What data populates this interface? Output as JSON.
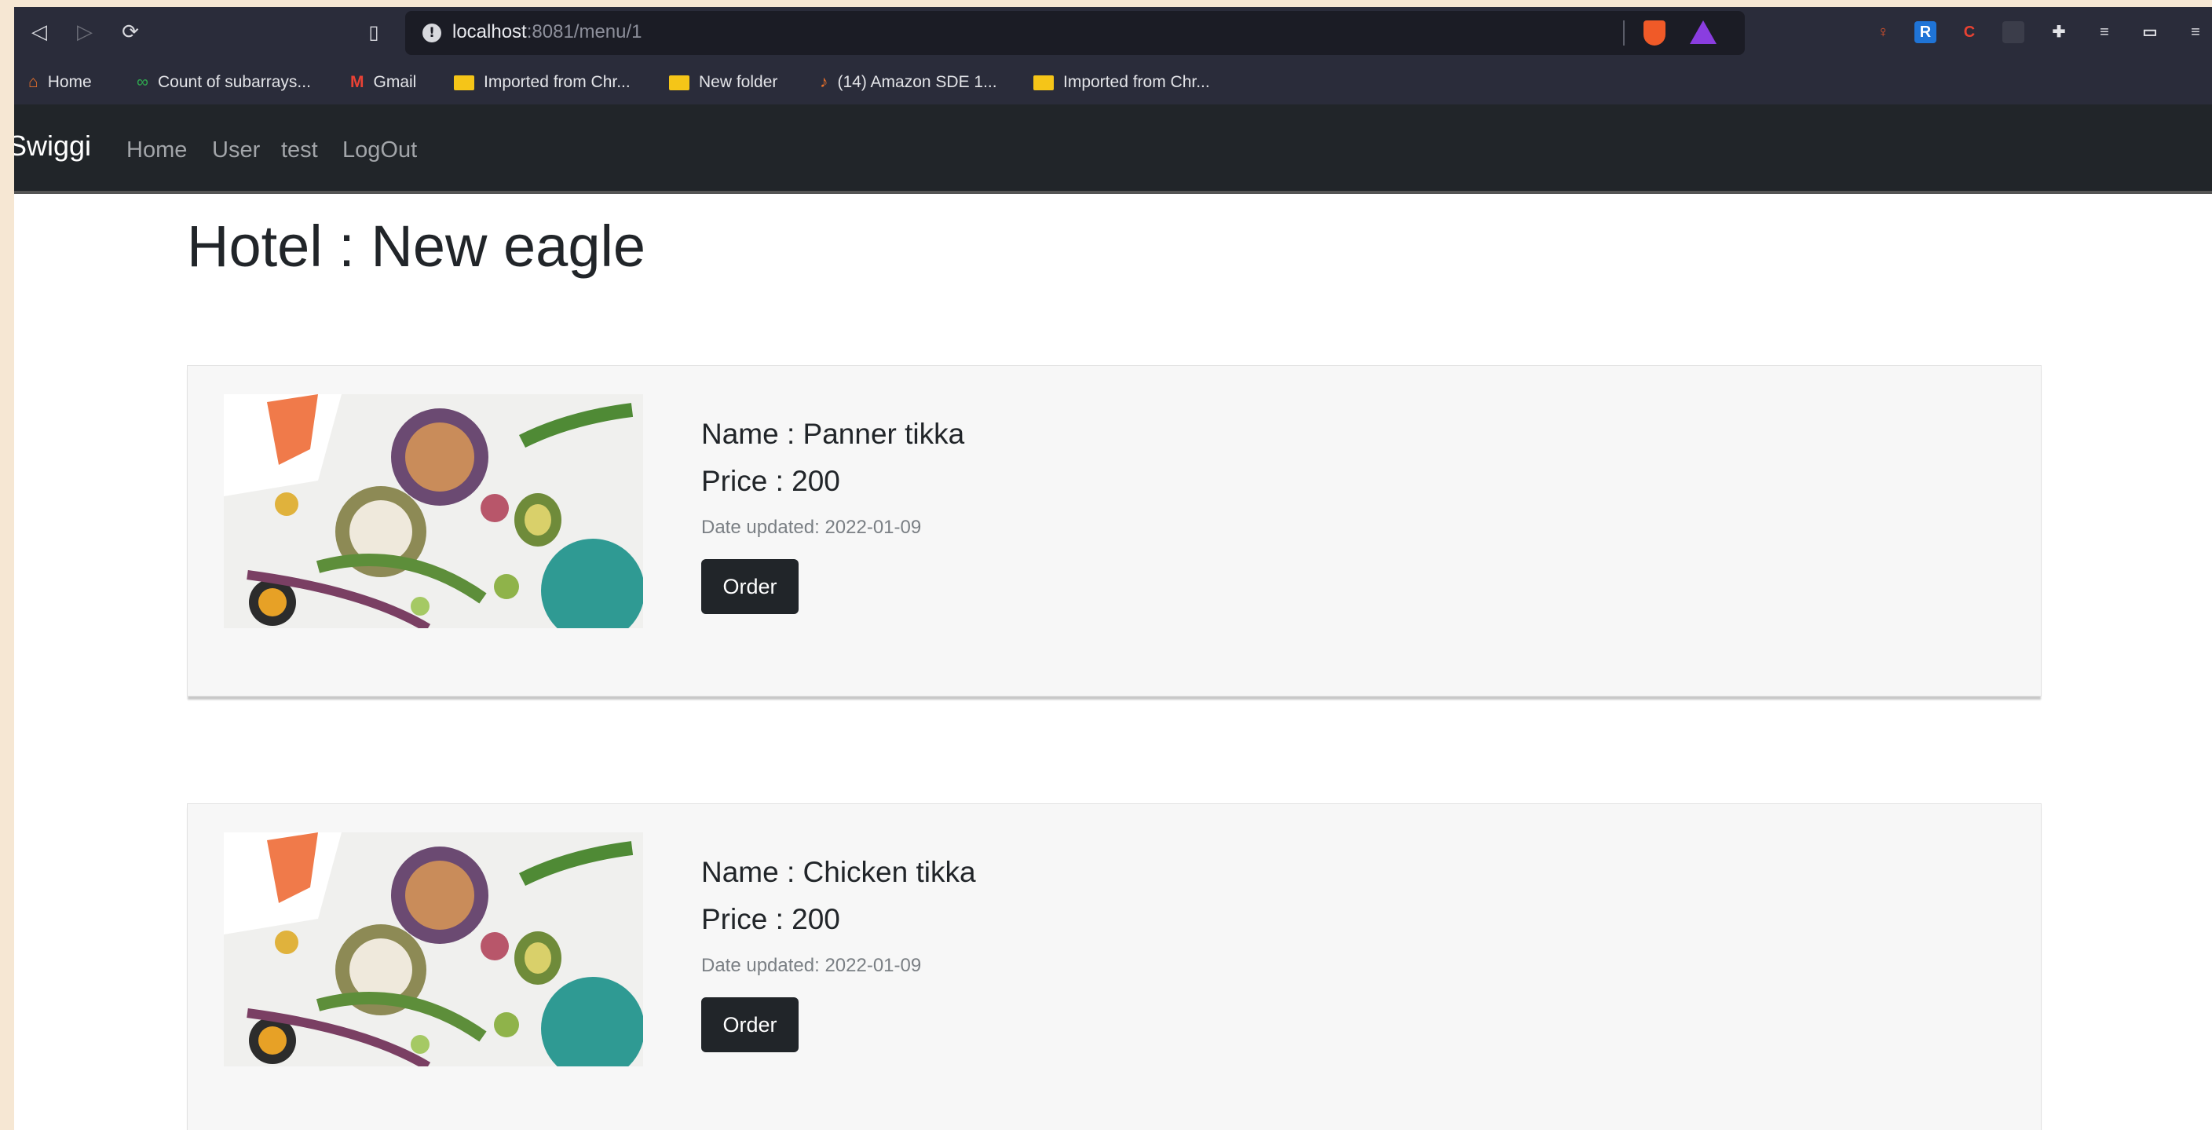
{
  "browser": {
    "url_host": "localhost",
    "url_rest": ":8081/menu/1",
    "bookmarks": [
      "Home",
      "Count of subarrays...",
      "Gmail",
      "Imported from Chr...",
      "New folder",
      "(14) Amazon SDE 1...",
      "Imported from Chr..."
    ]
  },
  "navbar": {
    "brand": "Swiggi",
    "links": [
      "Home",
      "User",
      "test",
      "LogOut"
    ]
  },
  "page": {
    "title": "Hotel : New eagle"
  },
  "items": [
    {
      "name": "Name : Panner tikka",
      "price": "Price : 200",
      "date": "Date updated: 2022-01-09",
      "button": "Order"
    },
    {
      "name": "Name : Chicken tikka",
      "price": "Price : 200",
      "date": "Date updated: 2022-01-09",
      "button": "Order"
    }
  ],
  "colors": {
    "navbar_bg": "#212529",
    "chrome_bg": "#2a2c3a",
    "card_bg": "#f7f7f7",
    "button_bg": "#212529"
  }
}
